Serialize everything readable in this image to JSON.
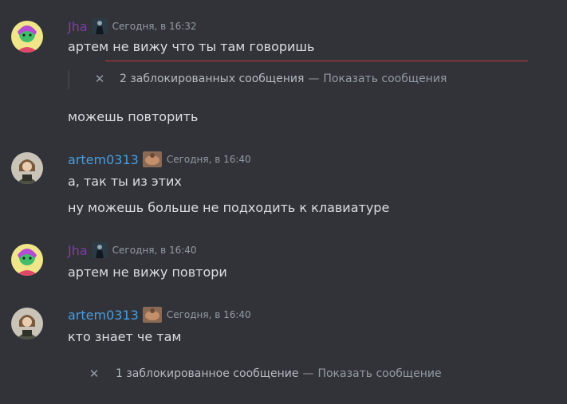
{
  "colors": {
    "background": "#313338",
    "jha_name": "#7b3fa8",
    "artem_name": "#4a9de0",
    "timestamp": "#949ba4",
    "text": "#dbdee1",
    "new_divider": "#c4393c"
  },
  "messages": [
    {
      "author": "Jha",
      "timestamp": "Сегодня, в 16:32",
      "lines": [
        "артем не вижу что ты там говоришь"
      ]
    },
    {
      "blocked_count": "2 заблокированных сообщения",
      "dash": "—",
      "show_label": "Показать сообщения"
    },
    {
      "lines": [
        "можешь повторить"
      ]
    },
    {
      "author": "artem0313",
      "timestamp": "Сегодня, в 16:40",
      "lines": [
        "а, так ты из этих",
        "ну можешь больше не подходить к клавиатуре"
      ]
    },
    {
      "author": "Jha",
      "timestamp": "Сегодня, в 16:40",
      "lines": [
        "артем не вижу повтори"
      ]
    },
    {
      "author": "artem0313",
      "timestamp": "Сегодня, в 16:40",
      "lines": [
        "кто знает че там"
      ]
    },
    {
      "blocked_count": "1 заблокированное сообщение",
      "dash": "—",
      "show_label": "Показать сообщение"
    }
  ],
  "icons": {
    "close": "close-icon",
    "jha_avatar": "green-anime-avatar",
    "artem_avatar": "soldier-avatar",
    "jha_badge": "dark-figure-badge",
    "artem_badge": "muscle-badge"
  }
}
